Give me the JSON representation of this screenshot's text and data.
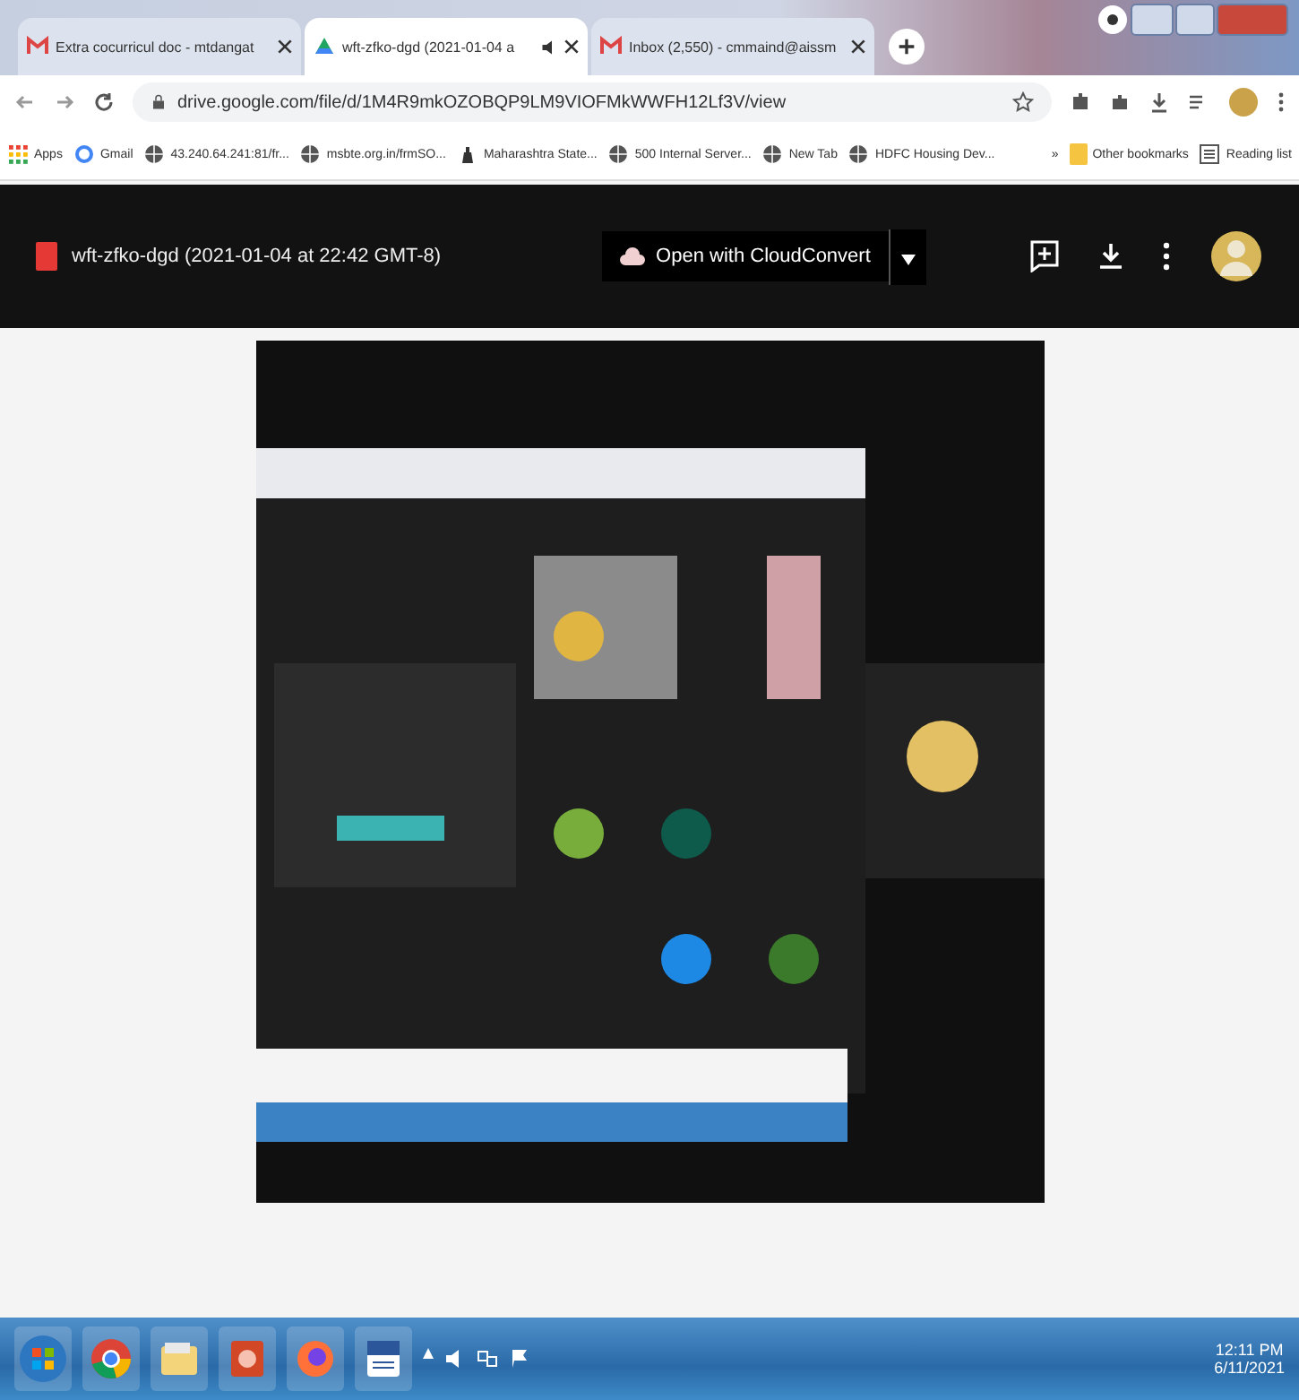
{
  "tabs": [
    {
      "title": "Extra cocurricul doc - mtdangat",
      "kind": "mail",
      "selected": false,
      "audio": false
    },
    {
      "title": "wft-zfko-dgd (2021-01-04 a",
      "kind": "drive",
      "selected": true,
      "audio": true
    },
    {
      "title": "Inbox (2,550) - cmmaind@aissm",
      "kind": "mail",
      "selected": false,
      "audio": false
    }
  ],
  "address_bar": {
    "url": "drive.google.com/file/d/1M4R9mkOZOBQP9LM9VIOFMkWWFH12Lf3V/view"
  },
  "bookmarks": [
    {
      "label": "Apps",
      "kind": "apps"
    },
    {
      "label": "Gmail",
      "kind": "google"
    },
    {
      "label": "43.240.64.241:81/fr...",
      "kind": "site"
    },
    {
      "label": "msbte.org.in/frmSO...",
      "kind": "site"
    },
    {
      "label": "Maharashtra State...",
      "kind": "emblem"
    },
    {
      "label": "500 Internal Server...",
      "kind": "site"
    },
    {
      "label": "New Tab",
      "kind": "site"
    },
    {
      "label": "HDFC Housing Dev...",
      "kind": "site"
    }
  ],
  "bookmarks_more": "»",
  "bookmarks_right": [
    {
      "label": "Other bookmarks",
      "kind": "folder"
    },
    {
      "label": "Reading list",
      "kind": "list"
    }
  ],
  "viewer": {
    "file_title": "wft-zfko-dgd (2021-01-04 at 22:42 GMT-8)",
    "open_with": "Open with CloudConvert"
  },
  "taskbar": {
    "time": "12:11 PM",
    "date": "6/11/2021"
  }
}
